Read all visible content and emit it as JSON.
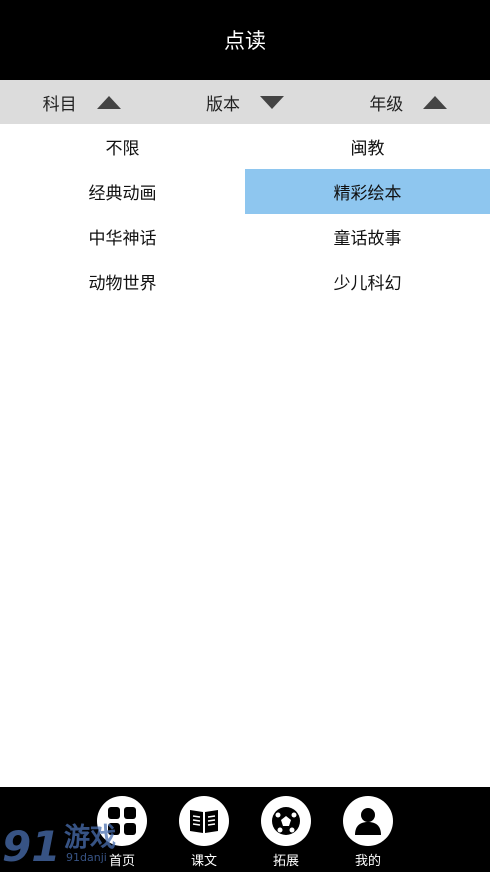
{
  "header": {
    "title": "点读"
  },
  "filters": [
    {
      "label": "科目",
      "arrow": "up"
    },
    {
      "label": "版本",
      "arrow": "down"
    },
    {
      "label": "年级",
      "arrow": "up"
    }
  ],
  "options": [
    {
      "label": "不限",
      "selected": false
    },
    {
      "label": "闽教",
      "selected": false
    },
    {
      "label": "经典动画",
      "selected": false
    },
    {
      "label": "精彩绘本",
      "selected": true
    },
    {
      "label": "中华神话",
      "selected": false
    },
    {
      "label": "童话故事",
      "selected": false
    },
    {
      "label": "动物世界",
      "selected": false
    },
    {
      "label": "少儿科幻",
      "selected": false
    }
  ],
  "tabs": [
    {
      "label": "首页",
      "icon": "grid-icon"
    },
    {
      "label": "课文",
      "icon": "book-icon"
    },
    {
      "label": "拓展",
      "icon": "ball-icon"
    },
    {
      "label": "我的",
      "icon": "user-icon"
    }
  ],
  "watermark": {
    "brand": "游戏",
    "site": "91danji"
  },
  "colors": {
    "header_bg": "#000000",
    "filter_bg": "#dcdcdc",
    "selected_bg": "#8ec6ef",
    "watermark": "#4a6fb0"
  }
}
